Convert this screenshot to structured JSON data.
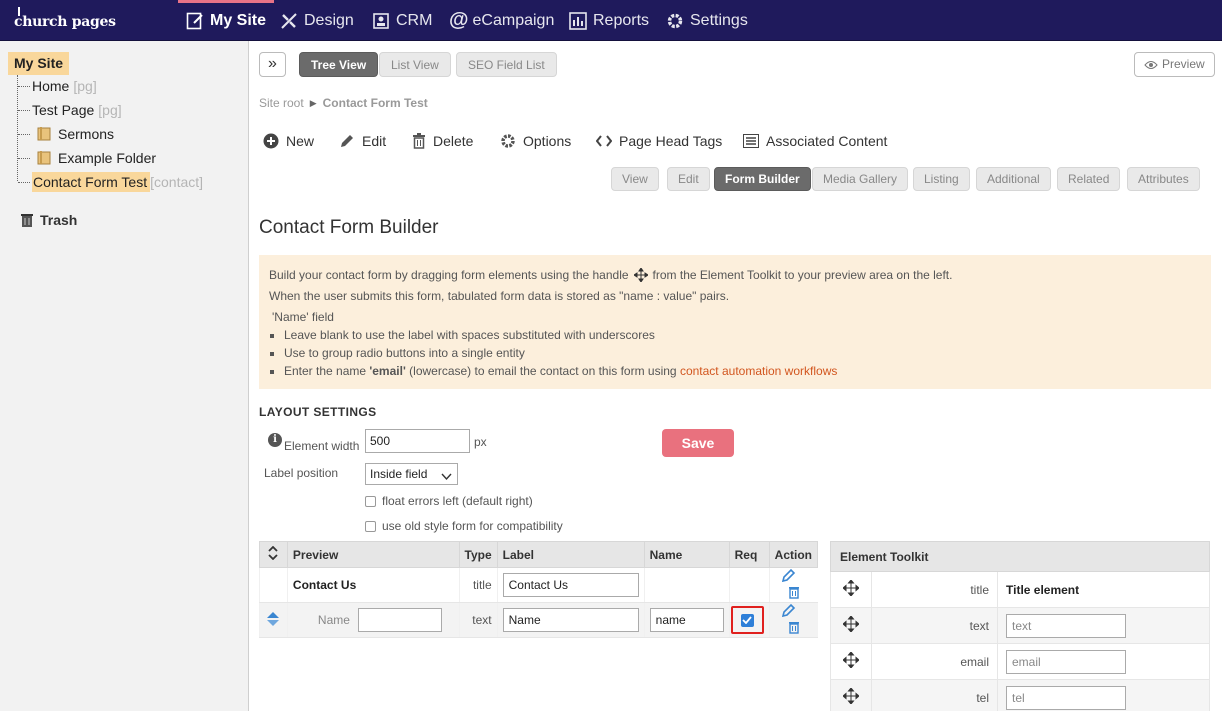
{
  "app": {
    "logo_text": "church pages"
  },
  "topnav": [
    {
      "label": "My Site",
      "icon": "edit-page-icon",
      "active": true
    },
    {
      "label": "Design",
      "icon": "design-tools-icon",
      "active": false
    },
    {
      "label": "CRM",
      "icon": "contacts-icon",
      "active": false
    },
    {
      "label": "eCampaign",
      "icon": "at-sign-icon",
      "active": false
    },
    {
      "label": "Reports",
      "icon": "bar-chart-icon",
      "active": false
    },
    {
      "label": "Settings",
      "icon": "gear-icon",
      "active": false
    }
  ],
  "sidebar": {
    "root": "My Site",
    "items": [
      {
        "label": "Home",
        "tag": "[pg]"
      },
      {
        "label": "Test Page",
        "tag": "[pg]"
      },
      {
        "label": "Sermons",
        "tag": ""
      },
      {
        "label": "Example Folder",
        "tag": ""
      },
      {
        "label": "Contact Form Test",
        "tag": "[contact]"
      }
    ],
    "trash": "Trash"
  },
  "toolbar": {
    "expand": "»",
    "views": [
      "Tree View",
      "List View",
      "SEO Field List"
    ],
    "active_view": "Tree View",
    "preview": "Preview"
  },
  "breadcrumb": {
    "root": "Site root",
    "current": "Contact Form Test"
  },
  "actions": [
    "New",
    "Edit",
    "Delete",
    "Options",
    "Page Head Tags",
    "Associated Content"
  ],
  "tabs": [
    "View",
    "Edit",
    "Form Builder",
    "Media Gallery",
    "Listing",
    "Additional",
    "Related",
    "Attributes"
  ],
  "active_tab": "Form Builder",
  "page_title": "Contact Form Builder",
  "info": {
    "line1_a": "Build your contact form by dragging form elements using the handle",
    "line1_b": "from the Element Toolkit to your preview area on the left.",
    "line2": "When the user submits this form, tabulated form data is stored as \"name : value\" pairs.",
    "name_head": "'Name' field",
    "bullet1": "Leave blank to use the label with spaces substituted with underscores",
    "bullet2": "Use to group radio buttons into a single entity",
    "bullet3_a": "Enter the name",
    "bullet3_b": "'email'",
    "bullet3_c": "(lowercase) to email the contact on this form using",
    "bullet3_link": "contact automation workflows"
  },
  "layout": {
    "title": "LAYOUT SETTINGS",
    "element_width_label": "Element width",
    "element_width_value": "500",
    "unit": "px",
    "label_position_label": "Label position",
    "label_position_value": "Inside field",
    "float_errors": "float errors left (default right)",
    "old_style": "use old style form for compatibility",
    "save": "Save"
  },
  "form_table": {
    "headers": {
      "preview": "Preview",
      "type": "Type",
      "label": "Label",
      "name": "Name",
      "req": "Req",
      "action": "Action"
    },
    "row1": {
      "preview": "Contact Us",
      "type": "title",
      "label": "Contact Us",
      "name": ""
    },
    "row2": {
      "preview": "Name",
      "type": "text",
      "label": "Name",
      "name": "name",
      "required": true
    }
  },
  "toolkit": {
    "title": "Element Toolkit",
    "rows": [
      {
        "type": "title",
        "value": "Title element"
      },
      {
        "type": "text",
        "placeholder": "text"
      },
      {
        "type": "email",
        "placeholder": "email"
      },
      {
        "type": "tel",
        "placeholder": "tel"
      }
    ]
  },
  "colors": {
    "nav_bg": "#1f1a5c",
    "selected_tree": "#f9d79b",
    "save_button": "#e9717e",
    "info_bg": "#fcefdc",
    "link": "#d2561f",
    "required_outline": "#e0201e"
  }
}
